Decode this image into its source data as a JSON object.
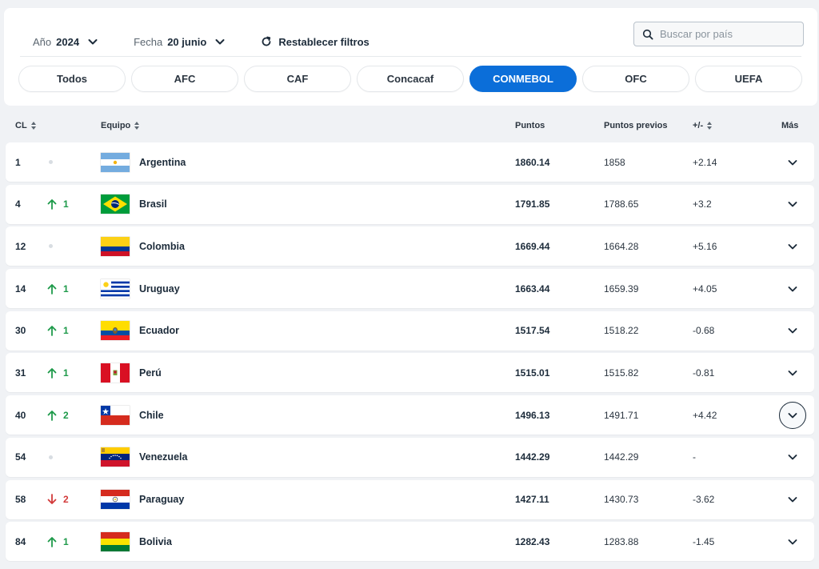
{
  "filters": {
    "year": {
      "label": "Año",
      "value": "2024"
    },
    "date": {
      "label": "Fecha",
      "value": "20 junio"
    },
    "reset_label": "Restablecer filtros",
    "search_placeholder": "Buscar por país"
  },
  "tabs": [
    {
      "label": "Todos"
    },
    {
      "label": "AFC"
    },
    {
      "label": "CAF"
    },
    {
      "label": "Concacaf"
    },
    {
      "label": "CONMEBOL",
      "active": true
    },
    {
      "label": "OFC"
    },
    {
      "label": "UEFA"
    }
  ],
  "columns": {
    "rank": "CL",
    "team": "Equipo",
    "points": "Puntos",
    "previous": "Puntos previos",
    "diff": "+/-",
    "more": "Más"
  },
  "colors": {
    "accent": "#0b6ed9",
    "up": "#1e9a4a",
    "down": "#d23a3a"
  },
  "rows": [
    {
      "rank": "1",
      "move": "none",
      "move_value": "",
      "flag": "argentina-flag",
      "team": "Argentina",
      "points": "1860.14",
      "previous": "1858",
      "diff": "+2.14"
    },
    {
      "rank": "4",
      "move": "up",
      "move_value": "1",
      "flag": "brazil-flag",
      "team": "Brasil",
      "points": "1791.85",
      "previous": "1788.65",
      "diff": "+3.2"
    },
    {
      "rank": "12",
      "move": "none",
      "move_value": "",
      "flag": "colombia-flag",
      "team": "Colombia",
      "points": "1669.44",
      "previous": "1664.28",
      "diff": "+5.16"
    },
    {
      "rank": "14",
      "move": "up",
      "move_value": "1",
      "flag": "uruguay-flag",
      "team": "Uruguay",
      "points": "1663.44",
      "previous": "1659.39",
      "diff": "+4.05"
    },
    {
      "rank": "30",
      "move": "up",
      "move_value": "1",
      "flag": "ecuador-flag",
      "team": "Ecuador",
      "points": "1517.54",
      "previous": "1518.22",
      "diff": "-0.68"
    },
    {
      "rank": "31",
      "move": "up",
      "move_value": "1",
      "flag": "peru-flag",
      "team": "Perú",
      "points": "1515.01",
      "previous": "1515.82",
      "diff": "-0.81"
    },
    {
      "rank": "40",
      "move": "up",
      "move_value": "2",
      "flag": "chile-flag",
      "team": "Chile",
      "points": "1496.13",
      "previous": "1491.71",
      "diff": "+4.42",
      "focused": true
    },
    {
      "rank": "54",
      "move": "none",
      "move_value": "",
      "flag": "venezuela-flag",
      "team": "Venezuela",
      "points": "1442.29",
      "previous": "1442.29",
      "diff": "-"
    },
    {
      "rank": "58",
      "move": "down",
      "move_value": "2",
      "flag": "paraguay-flag",
      "team": "Paraguay",
      "points": "1427.11",
      "previous": "1430.73",
      "diff": "-3.62"
    },
    {
      "rank": "84",
      "move": "up",
      "move_value": "1",
      "flag": "bolivia-flag",
      "team": "Bolivia",
      "points": "1282.43",
      "previous": "1283.88",
      "diff": "-1.45"
    }
  ]
}
